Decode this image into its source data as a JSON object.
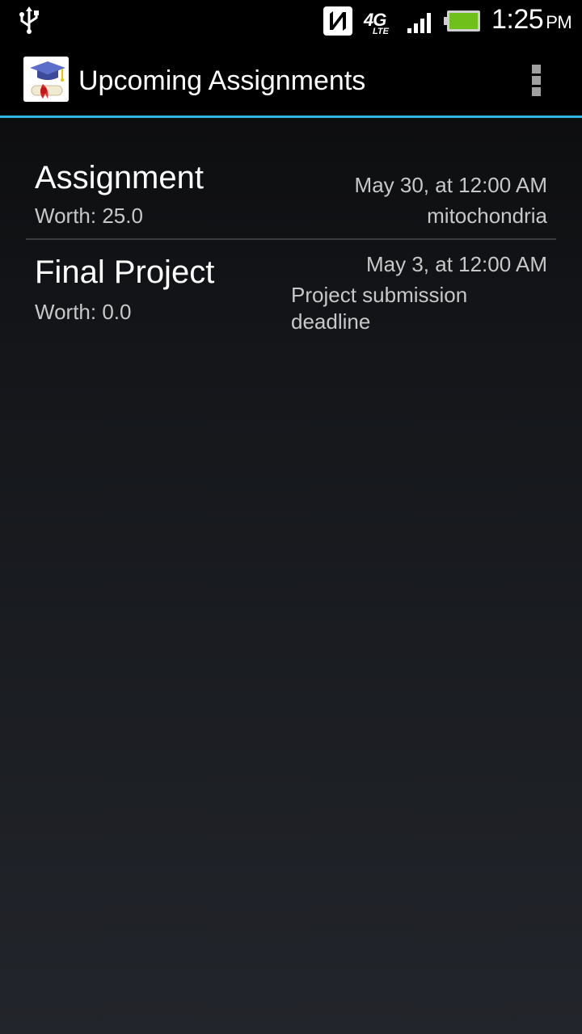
{
  "status_bar": {
    "time": "1:25",
    "ampm": "PM",
    "network_big": "4G",
    "network_small": "LTE",
    "icons": [
      "usb-icon",
      "nfc-icon",
      "4g-lte-icon",
      "signal-icon",
      "battery-icon"
    ],
    "battery_color": "#6fc01a"
  },
  "action_bar": {
    "title": "Upcoming Assignments",
    "accent_color": "#33b5e5",
    "icons": [
      "graduation-cap-diploma-icon",
      "overflow-menu-icon"
    ]
  },
  "assignments": [
    {
      "title": "Assignment",
      "worth": "Worth: 25.0",
      "date": "May 30, at 12:00 AM",
      "description": "mitochondria"
    },
    {
      "title": "Final Project",
      "worth": "Worth: 0.0",
      "date": "May 3, at 12:00 AM",
      "description_lines": [
        "Project submission",
        "deadline"
      ]
    }
  ]
}
